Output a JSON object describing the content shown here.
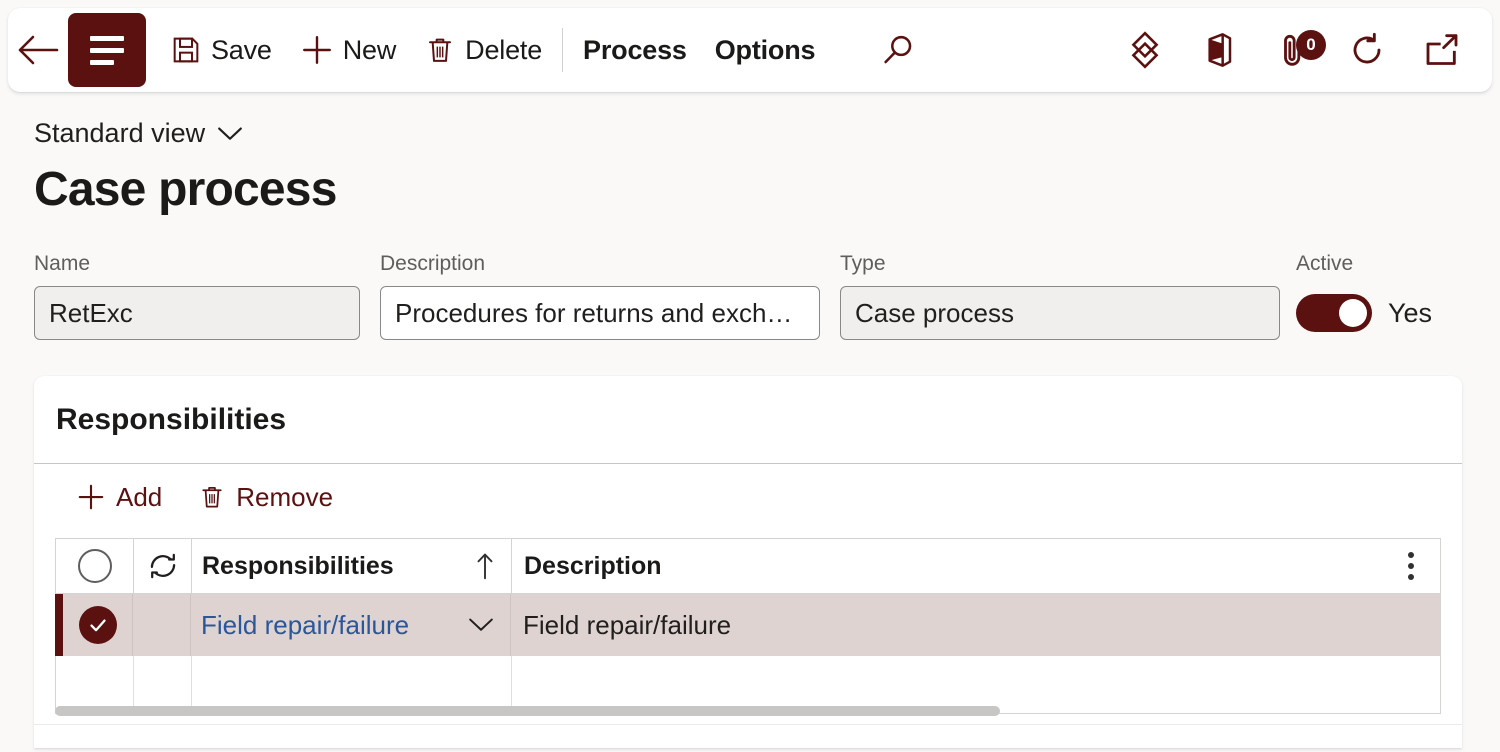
{
  "theme": {
    "accent": "#5c1111",
    "link": "#2b579a",
    "selected_row_bg": "#ded3d1",
    "page_bg": "#faf9f8",
    "readonly_field_bg": "#f0efee"
  },
  "commandbar": {
    "back_icon": "back-arrow-icon",
    "menu_icon": "hamburger-menu-icon",
    "items": [
      {
        "label": "Save",
        "icon": "save-icon"
      },
      {
        "label": "New",
        "icon": "add-icon"
      },
      {
        "label": "Delete",
        "icon": "trash-icon"
      }
    ],
    "menus": [
      {
        "label": "Process"
      },
      {
        "label": "Options"
      }
    ],
    "right_icons": [
      {
        "name": "search-icon"
      },
      {
        "name": "dynamics-diamond-icon"
      },
      {
        "name": "office-365-icon"
      },
      {
        "name": "attachments-icon",
        "badge": "0"
      },
      {
        "name": "refresh-icon"
      },
      {
        "name": "open-in-new-window-icon"
      }
    ]
  },
  "header": {
    "view_selector": "Standard view",
    "view_chevron": "chevron-down-icon",
    "title": "Case process"
  },
  "fields": {
    "name": {
      "label": "Name",
      "value": "RetExc",
      "readonly": true
    },
    "description": {
      "label": "Description",
      "value": "Procedures for returns and exch…",
      "readonly": false
    },
    "type": {
      "label": "Type",
      "value": "Case process",
      "readonly": true
    },
    "active": {
      "label": "Active",
      "value": "Yes",
      "toggle_on": true
    }
  },
  "responsibilities": {
    "section_title": "Responsibilities",
    "toolbar": [
      {
        "label": "Add",
        "icon": "add-icon"
      },
      {
        "label": "Remove",
        "icon": "trash-icon"
      }
    ],
    "grid": {
      "select_all_icon": "select-all-circle-icon",
      "sync_icon": "sync-icon",
      "column_options_icon": "column-options-kebab-icon",
      "columns": [
        {
          "label": "Responsibilities",
          "sort": "ascending",
          "sort_icon": "sort-arrow-up-icon"
        },
        {
          "label": "Description"
        }
      ],
      "rows": [
        {
          "selected": true,
          "check_icon": "checkmark-circle-filled-icon",
          "responsibility": "Field repair/failure",
          "expand_icon": "chevron-down-icon",
          "description": "Field repair/failure"
        },
        {
          "selected": false,
          "responsibility": "",
          "description": ""
        }
      ]
    }
  }
}
